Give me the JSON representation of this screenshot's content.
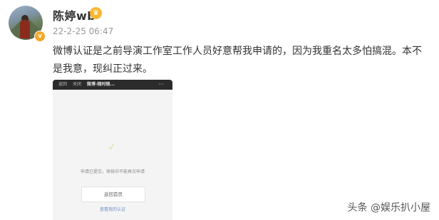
{
  "post": {
    "username": "陈婷wb",
    "timestamp": "22-2-25 06:47",
    "text": "微博认证是之前导演工作室工作人员好意帮我申请的，因为我重名太多怕搞混。本不是我意，现纠正过来。"
  },
  "icons": {
    "verified": "verified-badge-icon",
    "vip": "vip-crown-icon"
  },
  "screenshot": {
    "top_left": "返回",
    "top_close": "关闭",
    "top_title": "微博-随时随...",
    "top_menu": "···",
    "message": "申请已提交，审核中不能再次申请",
    "button": "返回首页",
    "link": "查看我的认证"
  },
  "watermark": "头条 @娱乐扒小屋",
  "colors": {
    "verified": "#f5a623",
    "text": "#333333",
    "muted": "#999999"
  }
}
